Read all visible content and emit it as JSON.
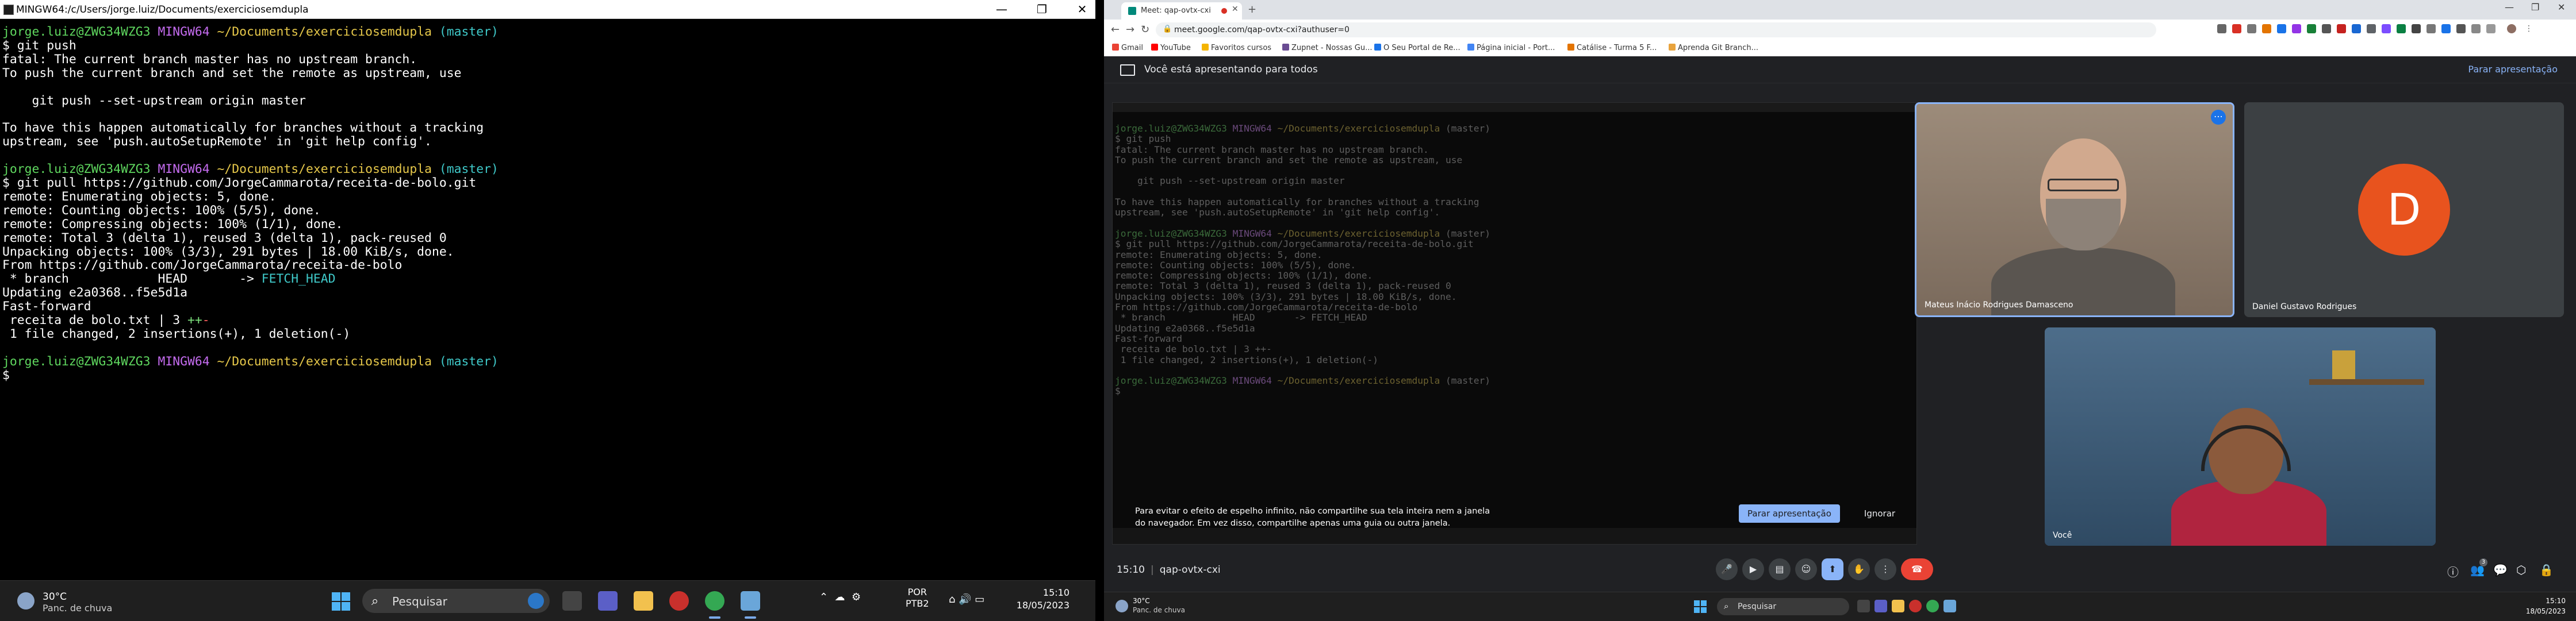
{
  "terminal": {
    "title": "MINGW64:/c/Users/jorge.luiz/Documents/exerciciosemdupla",
    "prompt_user": "jorge.luiz@ZWG34WZG3",
    "prompt_shell": "MINGW64",
    "prompt_path": "~/Documents/exerciciosemdupla",
    "prompt_branch": "(master)",
    "cmd1": "$ git push",
    "out1": [
      "fatal: The current branch master has no upstream branch.",
      "To push the current branch and set the remote as upstream, use",
      "",
      "    git push --set-upstream origin master",
      "",
      "To have this happen automatically for branches without a tracking",
      "upstream, see 'push.autoSetupRemote' in 'git help config'.",
      ""
    ],
    "cmd2": "$ git pull https://github.com/JorgeCammarota/receita-de-bolo.git",
    "out2": [
      "remote: Enumerating objects: 5, done.",
      "remote: Counting objects: 100% (5/5), done.",
      "remote: Compressing objects: 100% (1/1), done.",
      "remote: Total 3 (delta 1), reused 3 (delta 1), pack-reused 0",
      "Unpacking objects: 100% (3/3), 291 bytes | 18.00 KiB/s, done.",
      "From https://github.com/JorgeCammarota/receita-de-bolo"
    ],
    "fetch_line_a": " * branch            HEAD       -> ",
    "fetch_line_b": "FETCH_HEAD",
    "updating": "Updating e2a0368..f5e5d1a",
    "fast_forward": "Fast-forward",
    "file_line_a": " receita de bolo.txt | 3 ",
    "file_line_plus": "++",
    "file_line_minus": "-",
    "summary": " 1 file changed, 2 insertions(+), 1 deletion(-)",
    "final_prompt": "$"
  },
  "left_taskbar": {
    "weather_temp": "30°C",
    "weather_desc": "Panc. de chuva",
    "search_label": "Pesquisar",
    "lang_1": "POR",
    "lang_2": "PTB2",
    "time": "15:10",
    "date": "18/05/2023"
  },
  "browser": {
    "tab_title": "Meet: qap-ovtx-cxi",
    "url": "meet.google.com/qap-ovtx-cxi?authuser=0",
    "bookmarks": [
      "Gmail",
      "YouTube",
      "Favoritos cursos",
      "Zupnet - Nossas Gu...",
      "O Seu Portal de Re...",
      "Página inicial - Port...",
      "Catálise - Turma 5 F...",
      "Aprenda Git Branch..."
    ],
    "bookmark_colors": [
      "#ea4335",
      "#ff0000",
      "#f4b400",
      "#6a4c93",
      "#1a73e8",
      "#4285f4",
      "#e37400",
      "#e8a33d"
    ]
  },
  "meet": {
    "presenting_text": "Você está apresentando para todos",
    "stop_presenting_top": "Parar apresentação",
    "warning_text": "Para evitar o efeito de espelho infinito, não compartilhe sua tela inteira nem a janela do navegador. Em vez disso, compartilhe apenas uma guia ou outra janela.",
    "stop_presenting_button": "Parar apresentação",
    "ignore_button": "Ignorar",
    "participants": {
      "mateus": "Mateus Inácio Rodrigues Damasceno",
      "daniel": "Daniel Gustavo Rodrigues",
      "daniel_initial": "D",
      "self": "Você"
    },
    "time": "15:10",
    "meeting_code": "qap-ovtx-cxi",
    "participant_count": "3"
  },
  "right_taskbar": {
    "weather_temp": "30°C",
    "weather_desc": "Panc. de chuva",
    "search_label": "Pesquisar",
    "time": "15:10",
    "date": "18/05/2023"
  },
  "colors": {
    "prompt_green": "#5fd75f",
    "prompt_purple": "#c56cf0",
    "prompt_yellow": "#e6c84a",
    "meet_accent": "#8ab4f8",
    "leave_red": "#ea4335",
    "daniel_avatar": "#e8531e"
  }
}
